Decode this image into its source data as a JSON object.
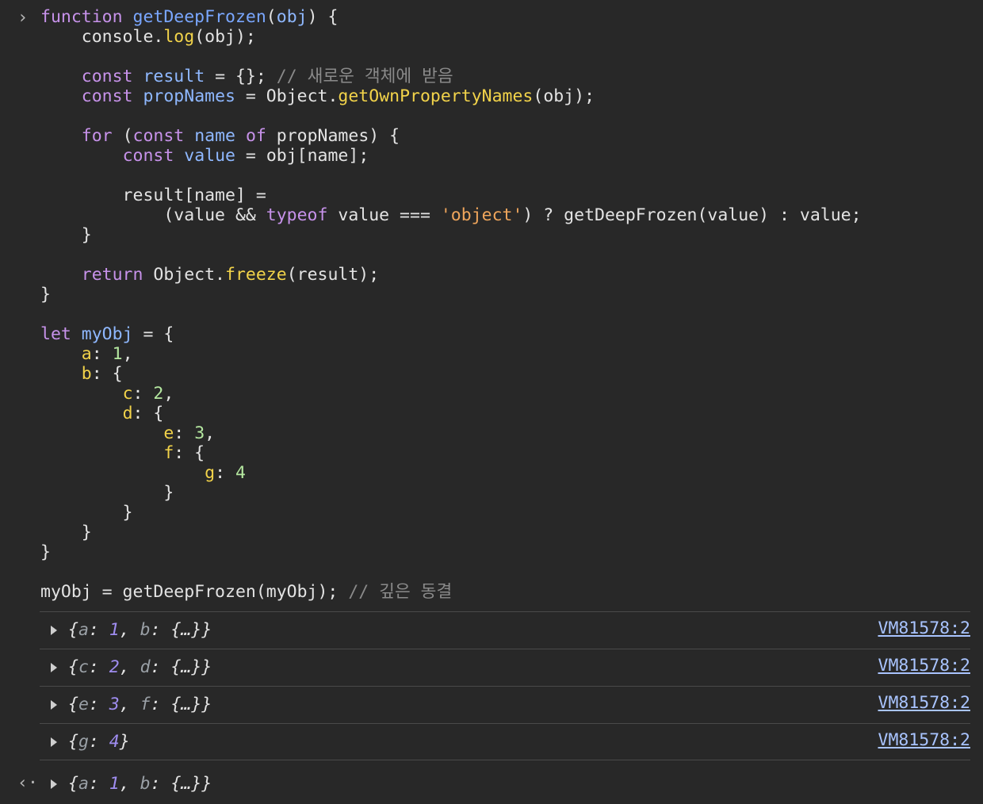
{
  "input_prompt": "›",
  "return_prompt": "‹·",
  "code_lines": [
    [
      {
        "t": "function",
        "c": "keyword"
      },
      {
        "t": " ",
        "c": "plain"
      },
      {
        "t": "getDeepFrozen",
        "c": "fn"
      },
      {
        "t": "(",
        "c": "punct"
      },
      {
        "t": "obj",
        "c": "def"
      },
      {
        "t": ") {",
        "c": "punct"
      }
    ],
    [
      {
        "t": "    console.",
        "c": "plain"
      },
      {
        "t": "log",
        "c": "builtin"
      },
      {
        "t": "(obj);",
        "c": "plain"
      }
    ],
    [],
    [
      {
        "t": "    ",
        "c": "plain"
      },
      {
        "t": "const",
        "c": "keyword"
      },
      {
        "t": " ",
        "c": "plain"
      },
      {
        "t": "result",
        "c": "def"
      },
      {
        "t": " = {}; ",
        "c": "plain"
      },
      {
        "t": "// 새로운 객체에 받음",
        "c": "comment"
      }
    ],
    [
      {
        "t": "    ",
        "c": "plain"
      },
      {
        "t": "const",
        "c": "keyword"
      },
      {
        "t": " ",
        "c": "plain"
      },
      {
        "t": "propNames",
        "c": "def"
      },
      {
        "t": " = Object.",
        "c": "plain"
      },
      {
        "t": "getOwnPropertyNames",
        "c": "builtin"
      },
      {
        "t": "(obj);",
        "c": "plain"
      }
    ],
    [],
    [
      {
        "t": "    ",
        "c": "plain"
      },
      {
        "t": "for",
        "c": "keyword"
      },
      {
        "t": " (",
        "c": "plain"
      },
      {
        "t": "const",
        "c": "keyword"
      },
      {
        "t": " ",
        "c": "plain"
      },
      {
        "t": "name",
        "c": "def"
      },
      {
        "t": " ",
        "c": "plain"
      },
      {
        "t": "of",
        "c": "keyword"
      },
      {
        "t": " propNames) {",
        "c": "plain"
      }
    ],
    [
      {
        "t": "        ",
        "c": "plain"
      },
      {
        "t": "const",
        "c": "keyword"
      },
      {
        "t": " ",
        "c": "plain"
      },
      {
        "t": "value",
        "c": "def"
      },
      {
        "t": " = obj[name];",
        "c": "plain"
      }
    ],
    [],
    [
      {
        "t": "        result[name] =",
        "c": "plain"
      }
    ],
    [
      {
        "t": "            (value && ",
        "c": "plain"
      },
      {
        "t": "typeof",
        "c": "keyword"
      },
      {
        "t": " value === ",
        "c": "plain"
      },
      {
        "t": "'object'",
        "c": "str"
      },
      {
        "t": ") ? getDeepFrozen(value) : value;",
        "c": "plain"
      }
    ],
    [
      {
        "t": "    }",
        "c": "plain"
      }
    ],
    [],
    [
      {
        "t": "    ",
        "c": "plain"
      },
      {
        "t": "return",
        "c": "keyword"
      },
      {
        "t": " Object.",
        "c": "plain"
      },
      {
        "t": "freeze",
        "c": "builtin"
      },
      {
        "t": "(result);",
        "c": "plain"
      }
    ],
    [
      {
        "t": "}",
        "c": "plain"
      }
    ],
    [],
    [
      {
        "t": "let",
        "c": "keyword"
      },
      {
        "t": " ",
        "c": "plain"
      },
      {
        "t": "myObj",
        "c": "def"
      },
      {
        "t": " = {",
        "c": "plain"
      }
    ],
    [
      {
        "t": "    ",
        "c": "plain"
      },
      {
        "t": "a",
        "c": "prop"
      },
      {
        "t": ": ",
        "c": "plain"
      },
      {
        "t": "1",
        "c": "num"
      },
      {
        "t": ",",
        "c": "plain"
      }
    ],
    [
      {
        "t": "    ",
        "c": "plain"
      },
      {
        "t": "b",
        "c": "prop"
      },
      {
        "t": ": {",
        "c": "plain"
      }
    ],
    [
      {
        "t": "        ",
        "c": "plain"
      },
      {
        "t": "c",
        "c": "prop"
      },
      {
        "t": ": ",
        "c": "plain"
      },
      {
        "t": "2",
        "c": "num"
      },
      {
        "t": ",",
        "c": "plain"
      }
    ],
    [
      {
        "t": "        ",
        "c": "plain"
      },
      {
        "t": "d",
        "c": "prop"
      },
      {
        "t": ": {",
        "c": "plain"
      }
    ],
    [
      {
        "t": "            ",
        "c": "plain"
      },
      {
        "t": "e",
        "c": "prop"
      },
      {
        "t": ": ",
        "c": "plain"
      },
      {
        "t": "3",
        "c": "num"
      },
      {
        "t": ",",
        "c": "plain"
      }
    ],
    [
      {
        "t": "            ",
        "c": "plain"
      },
      {
        "t": "f",
        "c": "prop"
      },
      {
        "t": ": {",
        "c": "plain"
      }
    ],
    [
      {
        "t": "                ",
        "c": "plain"
      },
      {
        "t": "g",
        "c": "prop"
      },
      {
        "t": ": ",
        "c": "plain"
      },
      {
        "t": "4",
        "c": "num"
      }
    ],
    [
      {
        "t": "            }",
        "c": "plain"
      }
    ],
    [
      {
        "t": "        }",
        "c": "plain"
      }
    ],
    [
      {
        "t": "    }",
        "c": "plain"
      }
    ],
    [
      {
        "t": "}",
        "c": "plain"
      }
    ],
    [],
    [
      {
        "t": "myObj = getDeepFrozen(myObj); ",
        "c": "plain"
      },
      {
        "t": "// 깊은 동결",
        "c": "comment"
      }
    ]
  ],
  "log_entries": [
    {
      "entries": [
        {
          "k": "a",
          "v": "1"
        },
        {
          "k": "b",
          "v": "{…}"
        }
      ],
      "source": "VM81578:2"
    },
    {
      "entries": [
        {
          "k": "c",
          "v": "2"
        },
        {
          "k": "d",
          "v": "{…}"
        }
      ],
      "source": "VM81578:2"
    },
    {
      "entries": [
        {
          "k": "e",
          "v": "3"
        },
        {
          "k": "f",
          "v": "{…}"
        }
      ],
      "source": "VM81578:2"
    },
    {
      "entries": [
        {
          "k": "g",
          "v": "4"
        }
      ],
      "source": "VM81578:2"
    }
  ],
  "return_value": {
    "entries": [
      {
        "k": "a",
        "v": "1"
      },
      {
        "k": "b",
        "v": "{…}"
      }
    ]
  }
}
